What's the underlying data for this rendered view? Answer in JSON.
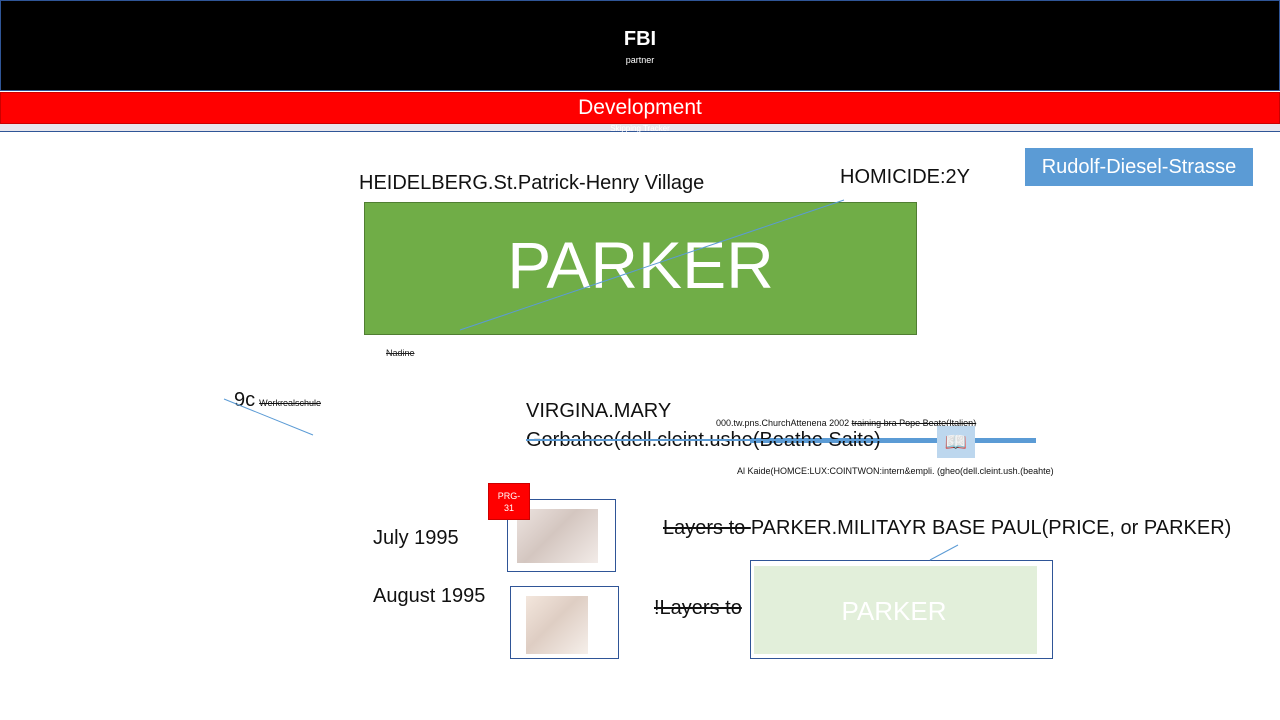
{
  "header": {
    "title": "FBI",
    "subtitle": "partner",
    "bar_title": "Development",
    "strip_text": "Skipping Tracker"
  },
  "upper": {
    "location": "HEIDELBERG.St.Patrick-Henry Village",
    "homicide": "HOMICIDE:2Y",
    "street_box": "Rudolf-Diesel-Strasse",
    "parker_box": "PARKER",
    "nadine": "Nadine"
  },
  "middle": {
    "nine_c": "9c",
    "school": "Werkrealschule",
    "virgina": "VIRGINA.MARY",
    "gorbahce": "Gorbahce(dell.cleint.ushe(Beathe Saito)",
    "church_prefix": "000.tw.pns.ChurchAttenena 2002 ",
    "church_struck": "training bra Pope Beate(Italien)",
    "alkaide": "Al Kaide(HOMCE:LUX:COINTWON:intern&empli. (gheo(dell.cleint.ush.(beahte)"
  },
  "lower": {
    "july": "July 1995",
    "august": "August 1995",
    "prg_badge": "PRG-31",
    "layers1_struck": "Layers to ",
    "layers1_rest": "PARKER.MILITAYR BASE PAUL(PRICE, or PARKER)",
    "layers2_struck": "!Layers to ",
    "parker_box2": "PARKER"
  },
  "colors": {
    "header_black": "#000000",
    "red_bar": "#ff0000",
    "green_box": "#70ad47",
    "blue_box": "#5b9bd5",
    "light_green": "#e2efda"
  }
}
